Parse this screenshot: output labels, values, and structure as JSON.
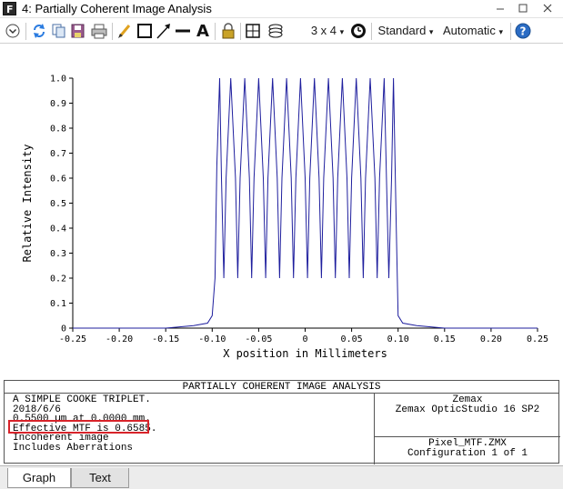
{
  "window": {
    "title": "4: Partially Coherent Image Analysis",
    "app_icon_letter": "F"
  },
  "toolbar": {
    "grid_label": "3 x 4",
    "standard_label": "Standard",
    "automatic_label": "Automatic",
    "dropdown_arrow": "▾",
    "text_tool_label": "A",
    "icons": [
      "collapse-icon",
      "refresh-icon",
      "copy-icon",
      "save-icon",
      "print-icon",
      "pencil-icon",
      "rectangle-icon",
      "arrow-line-icon",
      "line-icon",
      "text-icon",
      "lock-icon",
      "grid-icon",
      "layers-icon",
      "clock-icon",
      "help-icon"
    ]
  },
  "chart_data": {
    "type": "line",
    "title": "",
    "xlabel": "X position in Millimeters",
    "ylabel": "Relative Intensity",
    "xlim": [
      -0.25,
      0.25
    ],
    "ylim": [
      0,
      1
    ],
    "x_ticks": [
      "-0.25",
      "-0.20",
      "-0.15",
      "-0.10",
      "-0.05",
      "0",
      "0.05",
      "0.10",
      "0.15",
      "0.20",
      "0.25"
    ],
    "y_ticks": [
      "0",
      "0.1",
      "0.2",
      "0.3",
      "0.4",
      "0.5",
      "0.6",
      "0.7",
      "0.8",
      "0.9",
      "1.0"
    ],
    "line_color": "#1f1f9e",
    "grid": false,
    "series": [
      {
        "x": [
          -0.25,
          -0.15,
          -0.12,
          -0.105,
          -0.1,
          -0.097,
          -0.095,
          -0.092,
          -0.09,
          -0.0875,
          -0.085,
          -0.08,
          -0.075,
          -0.0725,
          -0.07,
          -0.065,
          -0.06,
          -0.0575,
          -0.055,
          -0.05,
          -0.045,
          -0.0425,
          -0.04,
          -0.035,
          -0.03,
          -0.0275,
          -0.025,
          -0.02,
          -0.015,
          -0.0125,
          -0.01,
          -0.005,
          0,
          0.0025,
          0.005,
          0.01,
          0.015,
          0.0175,
          0.02,
          0.025,
          0.03,
          0.0325,
          0.035,
          0.04,
          0.045,
          0.0475,
          0.05,
          0.055,
          0.06,
          0.0625,
          0.065,
          0.07,
          0.075,
          0.0775,
          0.08,
          0.085,
          0.0875,
          0.09,
          0.093,
          0.095,
          0.098,
          0.1,
          0.105,
          0.12,
          0.15,
          0.25
        ],
        "y": [
          0.0,
          0.0,
          0.01,
          0.02,
          0.05,
          0.2,
          0.65,
          1.0,
          0.6,
          0.2,
          0.6,
          1.0,
          0.6,
          0.2,
          0.6,
          1.0,
          0.6,
          0.2,
          0.6,
          1.0,
          0.6,
          0.2,
          0.6,
          1.0,
          0.6,
          0.2,
          0.6,
          1.0,
          0.6,
          0.2,
          0.6,
          1.0,
          0.6,
          0.2,
          0.6,
          1.0,
          0.6,
          0.2,
          0.6,
          1.0,
          0.6,
          0.2,
          0.6,
          1.0,
          0.6,
          0.2,
          0.6,
          1.0,
          0.6,
          0.2,
          0.6,
          1.0,
          0.6,
          0.2,
          0.6,
          1.0,
          0.6,
          0.2,
          0.6,
          1.0,
          0.4,
          0.05,
          0.02,
          0.01,
          0.0,
          0.0
        ]
      }
    ]
  },
  "info": {
    "header": "PARTIALLY COHERENT IMAGE ANALYSIS",
    "left_lines": [
      "A SIMPLE COOKE TRIPLET.",
      "2018/6/6",
      "0.5500 µm at 0.0000 mm.",
      "Effective MTF is 0.6585.",
      "Incoherent image",
      "Includes Aberrations"
    ],
    "right_top_lines": [
      "Zemax",
      "Zemax OpticStudio 16 SP2"
    ],
    "right_bottom_lines": [
      "Pixel_MTF.ZMX",
      "Configuration 1 of 1"
    ],
    "highlight_color": "#d8232a"
  },
  "tabs": [
    {
      "label": "Graph"
    },
    {
      "label": "Text"
    }
  ]
}
